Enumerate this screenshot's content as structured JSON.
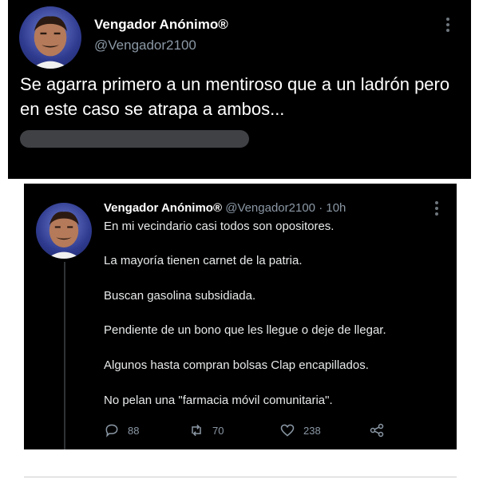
{
  "top_tweet": {
    "author_name": "Vengador Anónimo®",
    "author_handle": "@Vengador2100",
    "text": "Se agarra primero a un mentiroso que a un ladrón pero en este caso se atrapa a ambos..."
  },
  "bottom_tweet": {
    "author_name": "Vengador Anónimo®",
    "author_handle": "@Vengador2100",
    "separator": "·",
    "time": "10h",
    "lines": [
      "En mi vecindario casi todos son opositores.",
      "La mayoría tienen carnet de la patria.",
      "Buscan gasolina subsidiada.",
      "Pendiente de un bono que les llegue o deje de llegar.",
      "Algunos hasta compran bolsas Clap encapillados.",
      "No pelan una \"farmacia móvil comunitaria\"."
    ],
    "actions": {
      "replies": "88",
      "retweets": "70",
      "likes": "238"
    }
  },
  "icons": {
    "more": "more-dots-icon",
    "reply": "reply-bubble-icon",
    "retweet": "retweet-icon",
    "like": "heart-icon",
    "share": "share-icon"
  },
  "colors": {
    "background": "#000000",
    "text": "#e7e9ea",
    "muted": "#8b98a5"
  }
}
